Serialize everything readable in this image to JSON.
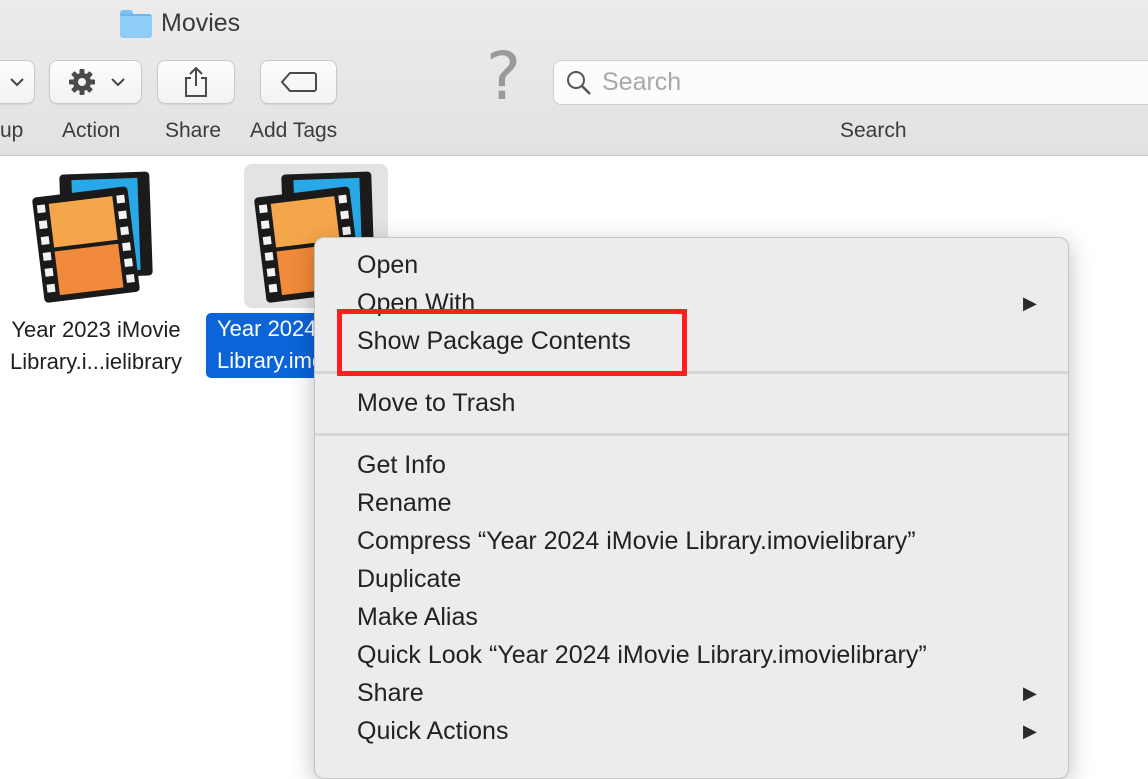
{
  "window": {
    "title": "Movies"
  },
  "toolbar": {
    "group_label": "up",
    "action_label": "Action",
    "share_label": "Share",
    "add_tags_label": "Add Tags",
    "search_label": "Search",
    "search_placeholder": "Search"
  },
  "files": [
    {
      "line1": "Year 2023 iMovie",
      "line2": "Library.i...ielibrary",
      "selected": false
    },
    {
      "line1": "Year 2024 iMovie",
      "line2": "Library.imovielibrary",
      "selected": true
    }
  ],
  "context_menu": {
    "items": [
      {
        "label": "Open"
      },
      {
        "label": "Open With",
        "submenu": true
      },
      {
        "label": "Show Package Contents",
        "highlighted": true
      },
      {
        "label": "Move to Trash"
      },
      {
        "label": "Get Info"
      },
      {
        "label": "Rename"
      },
      {
        "label": "Compress “Year 2024 iMovie Library.imovielibrary”"
      },
      {
        "label": "Duplicate"
      },
      {
        "label": "Make Alias"
      },
      {
        "label": "Quick Look “Year 2024 iMovie Library.imovielibrary”"
      },
      {
        "label": "Share",
        "submenu": true
      },
      {
        "label": "Quick Actions",
        "submenu": true
      }
    ]
  },
  "colors": {
    "selection": "#0b64d8",
    "highlight_box": "#ff1f1f",
    "folder": "#8fcdf7"
  }
}
